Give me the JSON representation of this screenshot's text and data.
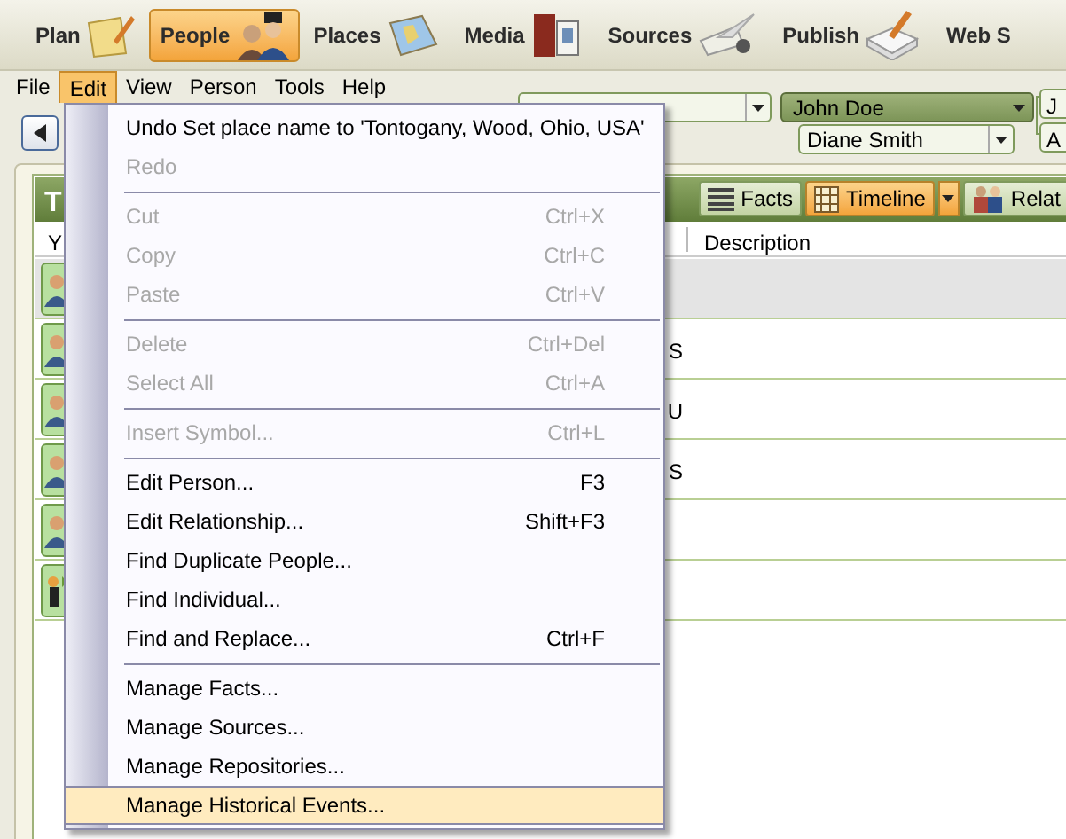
{
  "nav": [
    {
      "label": "Plan",
      "selected": false
    },
    {
      "label": "People",
      "selected": true
    },
    {
      "label": "Places",
      "selected": false
    },
    {
      "label": "Media",
      "selected": false
    },
    {
      "label": "Sources",
      "selected": false
    },
    {
      "label": "Publish",
      "selected": false
    },
    {
      "label": "Web S",
      "selected": false
    }
  ],
  "menu_bar": [
    {
      "label": "File",
      "selected": false
    },
    {
      "label": "Edit",
      "selected": true
    },
    {
      "label": "View",
      "selected": false
    },
    {
      "label": "Person",
      "selected": false
    },
    {
      "label": "Tools",
      "selected": false
    },
    {
      "label": "Help",
      "selected": false
    }
  ],
  "family": {
    "father": "John Doe",
    "mother": "Diane Smith",
    "child_1": "J",
    "child_2": "A"
  },
  "panel": {
    "title": "T",
    "views": [
      {
        "label": "Facts",
        "selected": false
      },
      {
        "label": "Timeline",
        "selected": true
      },
      {
        "label": "Relat",
        "selected": false
      }
    ],
    "columns": [
      "Y",
      "Description"
    ],
    "rows": [
      {
        "kind": "person",
        "selected": true
      },
      {
        "kind": "person",
        "selected": false,
        "column_2": "S"
      },
      {
        "kind": "person",
        "selected": false,
        "column_2": "U"
      },
      {
        "kind": "person",
        "selected": false,
        "column_2": "S"
      },
      {
        "kind": "person",
        "selected": false
      },
      {
        "kind": "event",
        "selected": false
      }
    ]
  },
  "edit_menu": [
    {
      "kind": "item",
      "label": "Undo Set place name to 'Tontogany, Wood, Ohio, USA'",
      "disabled": false,
      "selected": false
    },
    {
      "kind": "item",
      "label": "Redo",
      "disabled": true,
      "selected": false
    },
    {
      "kind": "separator"
    },
    {
      "kind": "item",
      "label": "Cut",
      "shortcut": "Ctrl+X",
      "disabled": true,
      "selected": false
    },
    {
      "kind": "item",
      "label": "Copy",
      "shortcut": "Ctrl+C",
      "disabled": true,
      "selected": false
    },
    {
      "kind": "item",
      "label": "Paste",
      "shortcut": "Ctrl+V",
      "disabled": true,
      "selected": false
    },
    {
      "kind": "separator"
    },
    {
      "kind": "item",
      "label": "Delete",
      "shortcut": "Ctrl+Del",
      "disabled": true,
      "selected": false
    },
    {
      "kind": "item",
      "label": "Select All",
      "shortcut": "Ctrl+A",
      "disabled": true,
      "selected": false
    },
    {
      "kind": "separator"
    },
    {
      "kind": "item",
      "label": "Insert Symbol...",
      "shortcut": "Ctrl+L",
      "disabled": true,
      "selected": false
    },
    {
      "kind": "separator"
    },
    {
      "kind": "item",
      "label": "Edit Person...",
      "shortcut": "F3",
      "disabled": false,
      "selected": false
    },
    {
      "kind": "item",
      "label": "Edit Relationship...",
      "shortcut": "Shift+F3",
      "disabled": false,
      "selected": false
    },
    {
      "kind": "item",
      "label": "Find Duplicate People...",
      "disabled": false,
      "selected": false
    },
    {
      "kind": "item",
      "label": "Find Individual...",
      "disabled": false,
      "selected": false
    },
    {
      "kind": "item",
      "label": "Find and Replace...",
      "shortcut": "Ctrl+F",
      "disabled": false,
      "selected": false
    },
    {
      "kind": "separator"
    },
    {
      "kind": "item",
      "label": "Manage Facts...",
      "disabled": false,
      "selected": false
    },
    {
      "kind": "item",
      "label": "Manage Sources...",
      "disabled": false,
      "selected": false
    },
    {
      "kind": "item",
      "label": "Manage Repositories...",
      "disabled": false,
      "selected": false
    },
    {
      "kind": "item",
      "label": "Manage Historical Events...",
      "disabled": false,
      "selected": true
    }
  ]
}
